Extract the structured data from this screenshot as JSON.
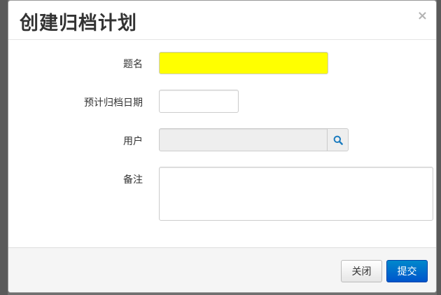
{
  "dialog": {
    "title": "创建归档计划",
    "close_glyph": "×"
  },
  "form": {
    "title_label": "题名",
    "title_value": "",
    "title_highlight_color": "#ffff00",
    "date_label": "预计归档日期",
    "date_value": "",
    "user_label": "用户",
    "user_value": "",
    "search_icon": "search-icon",
    "notes_label": "备注",
    "notes_value": ""
  },
  "footer": {
    "close_label": "关闭",
    "submit_label": "提交",
    "submit_color": "#0066cc"
  }
}
